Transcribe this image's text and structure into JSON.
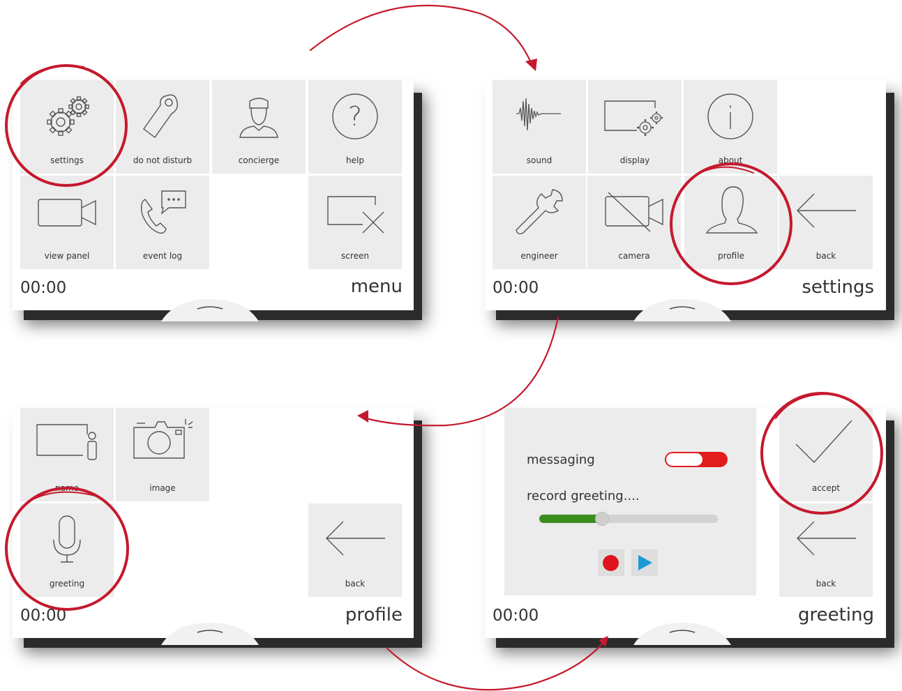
{
  "menu": {
    "title": "menu",
    "time": "00:00",
    "tiles": [
      "settings",
      "do not disturb",
      "concierge",
      "help",
      "view panel",
      "event log",
      "screen"
    ]
  },
  "settings": {
    "title": "settings",
    "time": "00:00",
    "tiles": [
      "sound",
      "display",
      "about",
      "engineer",
      "camera",
      "profile",
      "back"
    ]
  },
  "profile": {
    "title": "profile",
    "time": "00:00",
    "tiles": [
      "name",
      "image",
      "greeting",
      "back"
    ]
  },
  "greeting": {
    "title": "greeting",
    "time": "00:00",
    "messaging_label": "messaging",
    "messaging_on": true,
    "record_label": "record greeting....",
    "progress": 0.35,
    "tiles": [
      "accept",
      "back"
    ]
  },
  "colors": {
    "accent": "#c5192d",
    "tile": "#ececec",
    "progress": "#3d8c1e",
    "record": "#e0141e",
    "play": "#1c9ad6"
  },
  "icons": [
    "gears-icon",
    "door-hanger-icon",
    "concierge-icon",
    "help-icon",
    "video-camera-icon",
    "phone-chat-icon",
    "screen-off-icon",
    "waveform-icon",
    "display-gear-icon",
    "info-icon",
    "wrench-icon",
    "camera-off-icon",
    "person-icon",
    "back-arrow-icon",
    "name-card-icon",
    "photo-camera-icon",
    "microphone-icon",
    "check-icon",
    "record-icon",
    "play-icon"
  ]
}
